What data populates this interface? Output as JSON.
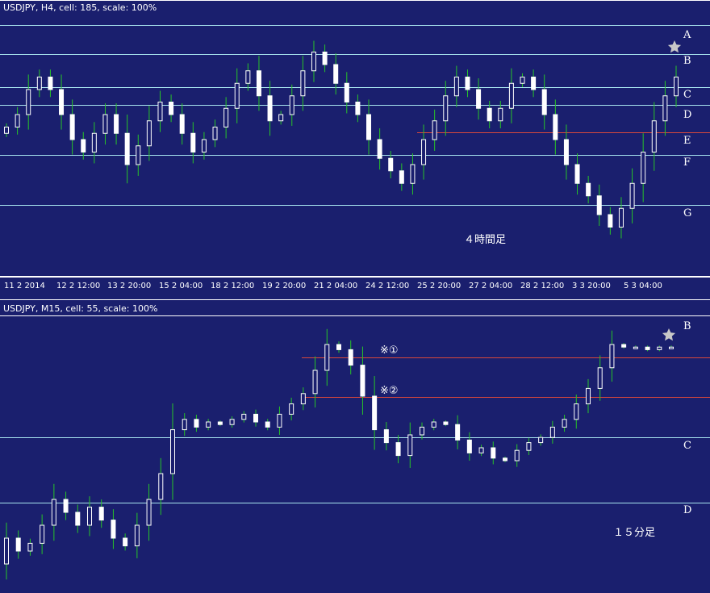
{
  "colors": {
    "background": "#1a1f6e",
    "level_line": "#a8e4ef",
    "red_line": "#d9483b",
    "candle": "#ffffff",
    "wick": "#28c428",
    "frame": "#ffffff",
    "star": "#c8c8c8"
  },
  "chart_data": [
    {
      "type": "candlestick",
      "header": "USDJPY, H4, cell: 185, scale: 100%",
      "note": "４時間足",
      "x_tick_labels": [
        "11 2 2014",
        "12 2 12:00",
        "13 2 20:00",
        "15 2 04:00",
        "18 2 12:00",
        "19 2 20:00",
        "21 2 04:00",
        "24 2 12:00",
        "25 2 20:00",
        "27 2 04:00",
        "28 2 12:00",
        "3 3 20:00",
        "5 3 04:00"
      ],
      "levels": [
        "A",
        "B",
        "C",
        "D",
        "E",
        "F",
        "G"
      ],
      "red_level": "E",
      "star_level": "B",
      "closes": [
        101.7,
        101.9,
        102.3,
        102.5,
        102.3,
        101.9,
        101.5,
        101.3,
        101.6,
        101.9,
        101.6,
        101.1,
        101.4,
        101.8,
        102.1,
        101.9,
        101.6,
        101.3,
        101.5,
        101.7,
        102.0,
        102.4,
        102.6,
        102.2,
        101.8,
        101.9,
        102.2,
        102.6,
        102.9,
        102.7,
        102.4,
        102.1,
        101.9,
        101.5,
        101.2,
        101.0,
        100.8,
        101.1,
        101.5,
        101.8,
        102.2,
        102.5,
        102.3,
        102.0,
        101.8,
        102.0,
        102.4,
        102.5,
        102.3,
        101.9,
        101.5,
        101.1,
        100.8,
        100.6,
        100.3,
        100.1,
        100.4,
        100.8,
        101.3,
        101.8,
        102.2,
        102.5
      ]
    },
    {
      "type": "candlestick",
      "header": "USDJPY, M15, cell: 55, scale: 100%",
      "note": "１５分足",
      "levels": [
        "B",
        "C",
        "D"
      ],
      "red_levels": [
        "※①",
        "※②"
      ],
      "star_level": "B",
      "closes": [
        101.9,
        101.85,
        101.88,
        101.95,
        102.05,
        102.0,
        101.95,
        102.02,
        101.97,
        101.9,
        101.87,
        101.95,
        102.05,
        102.15,
        102.32,
        102.36,
        102.33,
        102.35,
        102.34,
        102.36,
        102.38,
        102.35,
        102.33,
        102.38,
        102.42,
        102.46,
        102.55,
        102.65,
        102.63,
        102.57,
        102.45,
        102.32,
        102.27,
        102.22,
        102.3,
        102.33,
        102.35,
        102.34,
        102.28,
        102.23,
        102.25,
        102.21,
        102.2,
        102.24,
        102.27,
        102.29,
        102.33,
        102.36,
        102.42,
        102.48,
        102.56,
        102.65,
        102.64,
        102.64,
        102.63,
        102.64,
        102.64
      ]
    }
  ]
}
